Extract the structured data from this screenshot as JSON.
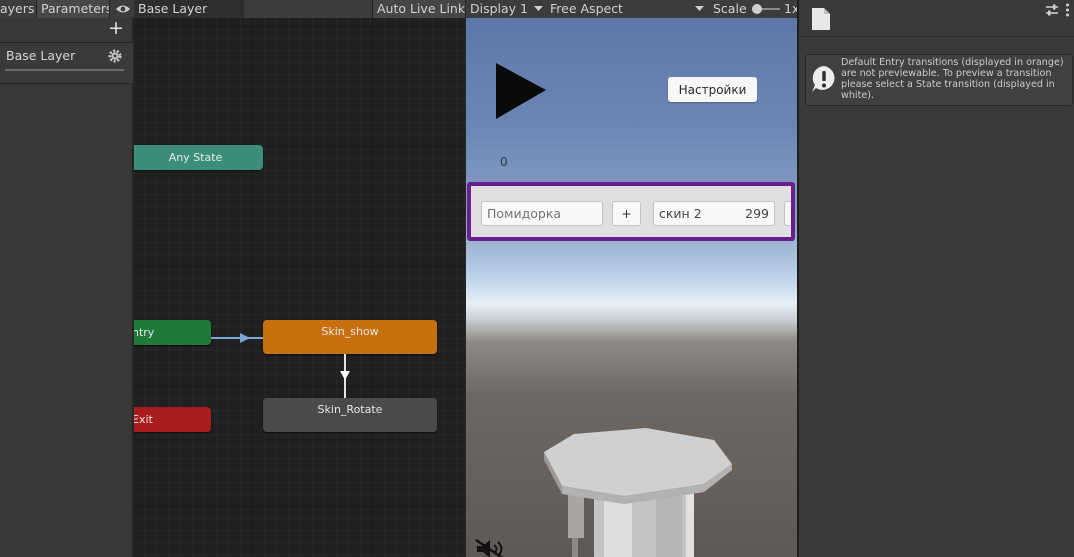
{
  "animator": {
    "tabs": {
      "layers": "ayers",
      "parameters": "Parameters",
      "base_layer": "Base Layer",
      "auto_live_link": "Auto Live Link"
    },
    "add_symbol": "+",
    "layer_name": "Base Layer",
    "nodes": {
      "any_state": "Any State",
      "entry": "ntry",
      "exit": "Exit",
      "skin_show": "Skin_show",
      "skin_rotate": "Skin_Rotate"
    },
    "colors": {
      "any_state": "#3b8f7a",
      "entry": "#1d7a37",
      "exit": "#a81c1c",
      "skin_show": "#c8700f",
      "skin_rotate": "#4a4a4a"
    }
  },
  "game_view": {
    "display": "Display 1",
    "aspect": "Free Aspect",
    "scale_label": "Scale",
    "scale_value": "1x",
    "settings_button": "Настройки",
    "score": "0",
    "shop": {
      "item_name": "Помидорка",
      "plus": "+",
      "skin_name": "скин 2",
      "skin_price": "299"
    },
    "highlight_color": "#6a1f8f"
  },
  "inspector": {
    "message": "Default Entry transitions (displayed in orange) are not previewable. To preview a transition please select a State transition (displayed in white)."
  }
}
